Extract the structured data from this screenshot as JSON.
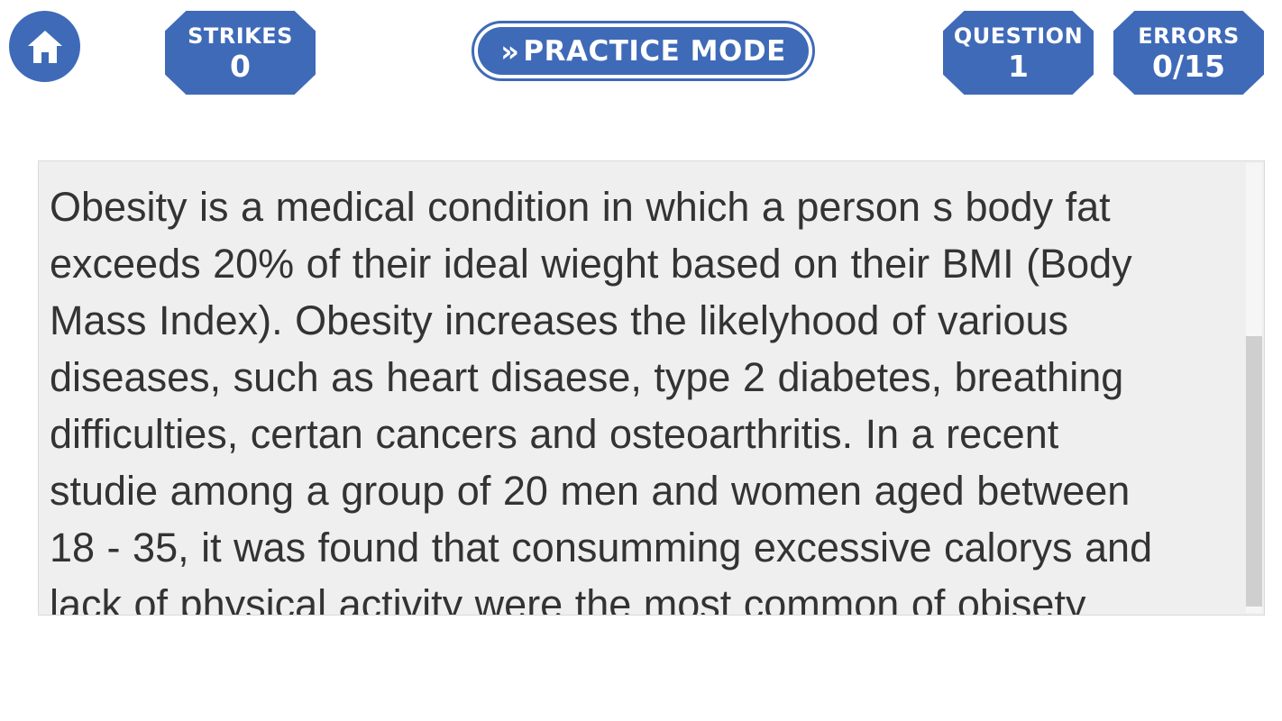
{
  "header": {
    "strikes": {
      "label": "STRIKES",
      "value": "0"
    },
    "mode": {
      "label": "PRACTICE MODE"
    },
    "question": {
      "label": "QUESTION",
      "value": "1"
    },
    "errors": {
      "label": "ERRORS",
      "value": "0/15"
    }
  },
  "passage": {
    "lines": [
      "Obesity is a medical condition in which a person s body fat",
      "exceeds 20% of their ideal wieght based on their BMI (Body",
      "Mass Index). Obesity increases the likelyhood of various",
      "diseases, such as heart disaese, type 2 diabetes, breathing",
      "difficulties, certan cancers and osteoarthritis. In a recent",
      "studie among a group of 20 men and women aged between",
      "18 - 35, it was found that consumming excessive calorys and",
      "lack of physical activity were the most common of obisety"
    ]
  },
  "icons": {
    "home": "home-icon",
    "mode": "double-chevron-right-icon"
  },
  "colors": {
    "accent": "#3f6ab8",
    "passage_background": "#efefef",
    "text": "#333333"
  }
}
